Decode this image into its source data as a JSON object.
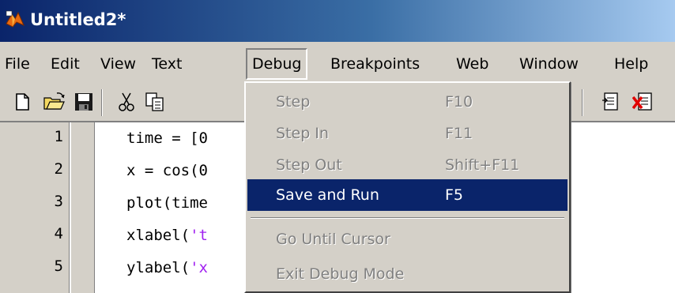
{
  "window": {
    "title": "Untitled2*",
    "titlebar_color": "#0a246a"
  },
  "menubar": {
    "items": [
      {
        "label": "File"
      },
      {
        "label": "Edit"
      },
      {
        "label": "View"
      },
      {
        "label": "Text"
      },
      {
        "label": "Debug",
        "open": true
      },
      {
        "label": "Breakpoints"
      },
      {
        "label": "Web"
      },
      {
        "label": "Window"
      },
      {
        "label": "Help"
      }
    ]
  },
  "toolbar": {
    "icons": [
      "new-file-icon",
      "open-folder-icon",
      "save-icon",
      "cut-icon",
      "copy-icon",
      "insert-icon",
      "clear-breakpoints-icon"
    ]
  },
  "editor": {
    "lines": [
      {
        "num": "1",
        "code": "time = [0"
      },
      {
        "num": "2",
        "code": "x = cos(0"
      },
      {
        "num": "3",
        "code": "plot(time"
      },
      {
        "num": "4",
        "code_pre": "xlabel(",
        "code_str": "'t"
      },
      {
        "num": "5",
        "code_pre": "ylabel(",
        "code_str": "'x"
      }
    ],
    "string_color": "#a020f0"
  },
  "debug_menu": {
    "items": [
      {
        "label": "Step",
        "shortcut": "F10",
        "enabled": false
      },
      {
        "label": "Step In",
        "shortcut": "F11",
        "enabled": false
      },
      {
        "label": "Step Out",
        "shortcut": "Shift+F11",
        "enabled": false
      },
      {
        "label": "Save and Run",
        "shortcut": "F5",
        "enabled": true,
        "highlighted": true
      },
      {
        "label": "Go Until Cursor",
        "shortcut": "",
        "enabled": false
      },
      {
        "label": "Exit Debug Mode",
        "shortcut": "",
        "enabled": false
      }
    ],
    "highlight_color": "#0a246a"
  }
}
